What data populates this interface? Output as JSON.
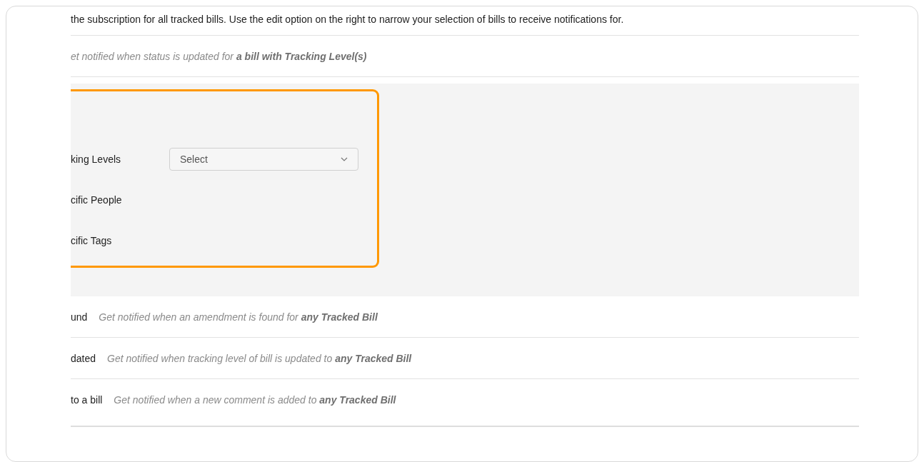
{
  "intro": "the subscription for all tracked bills. Use the edit option on the right to narrow your selection of bills to receive notifications for.",
  "status_row": {
    "description": "et notified when status is updated for **a bill with Tracking Level(s)**"
  },
  "filter_panel": {
    "highlighted": true,
    "filters": [
      {
        "kind": "select",
        "label": "king Levels",
        "placeholder": "Select"
      },
      {
        "kind": "plain",
        "label": "cific People"
      },
      {
        "kind": "plain",
        "label": "cific Tags"
      }
    ]
  },
  "rows": [
    {
      "label": "und",
      "description": "Get notified when an amendment is found for **any Tracked Bill**"
    },
    {
      "label": "dated",
      "description": "Get notified when tracking level of bill is updated to **any Tracked Bill**"
    },
    {
      "label": "to a bill",
      "description": "Get notified when a new comment is added to **any Tracked Bill**"
    }
  ]
}
